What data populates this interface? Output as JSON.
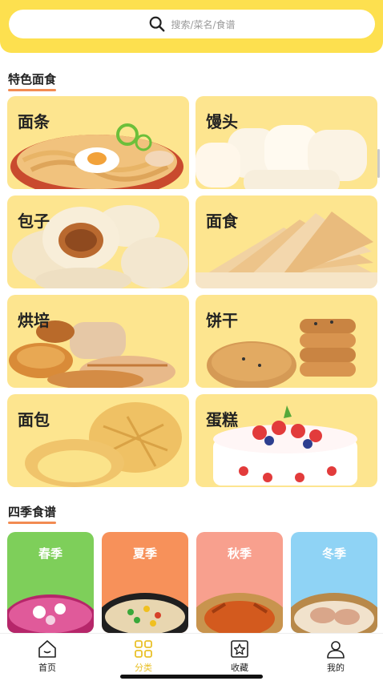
{
  "search": {
    "placeholder": "搜索/菜名/食谱",
    "icon": "search-icon"
  },
  "sections": {
    "featured": "特色面食",
    "seasons": "四季食谱"
  },
  "categories": [
    {
      "label": "面条"
    },
    {
      "label": "馒头"
    },
    {
      "label": "包子"
    },
    {
      "label": "面食"
    },
    {
      "label": "烘培"
    },
    {
      "label": "饼干"
    },
    {
      "label": "面包"
    },
    {
      "label": "蛋糕"
    }
  ],
  "season_cards": [
    {
      "label": "春季",
      "color": "#7ecf5a"
    },
    {
      "label": "夏季",
      "color": "#f7915a"
    },
    {
      "label": "秋季",
      "color": "#f8a08e"
    },
    {
      "label": "冬季",
      "color": "#8fd3f5"
    }
  ],
  "tabbar": {
    "items": [
      {
        "label": "首页",
        "icon": "home-icon"
      },
      {
        "label": "分类",
        "icon": "grid-icon",
        "active": true
      },
      {
        "label": "收藏",
        "icon": "star-box-icon"
      },
      {
        "label": "我的",
        "icon": "user-icon"
      }
    ]
  },
  "colors": {
    "accent": "#fde04f",
    "card_bg": "#fde58f",
    "active_tab": "#e9c12a",
    "underline": "#f28b52"
  }
}
